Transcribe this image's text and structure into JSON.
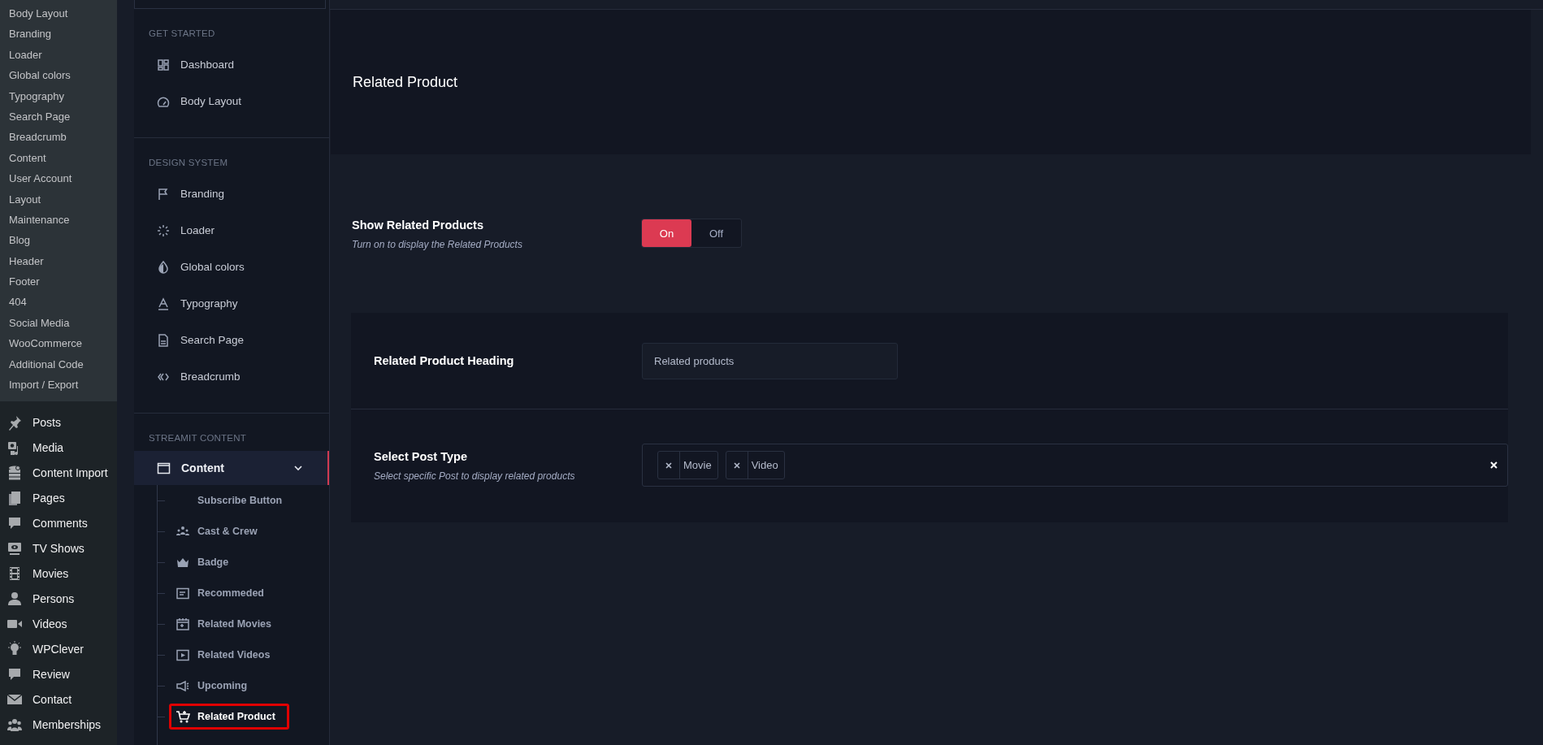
{
  "wp_submenu": [
    "Body Layout",
    "Branding",
    "Loader",
    "Global colors",
    "Typography",
    "Search Page",
    "Breadcrumb",
    "Content",
    "User Account",
    "Layout",
    "Maintenance",
    "Blog",
    "Header",
    "Footer",
    "404",
    "Social Media",
    "WooCommerce",
    "Additional Code",
    "Import / Export"
  ],
  "wp_menu": [
    "Posts",
    "Media",
    "Content Import",
    "Pages",
    "Comments",
    "TV Shows",
    "Movies",
    "Persons",
    "Videos",
    "WPClever",
    "Review",
    "Contact",
    "Memberships"
  ],
  "theme_sidebar": {
    "sections": [
      {
        "title": "GET STARTED",
        "items": [
          {
            "label": "Dashboard",
            "selected": false
          },
          {
            "label": "Body Layout",
            "selected": false
          }
        ]
      },
      {
        "title": "DESIGN SYSTEM",
        "items": [
          {
            "label": "Branding",
            "selected": false
          },
          {
            "label": "Loader",
            "selected": false
          },
          {
            "label": "Global colors",
            "selected": false
          },
          {
            "label": "Typography",
            "selected": false
          },
          {
            "label": "Search Page",
            "selected": false
          },
          {
            "label": "Breadcrumb",
            "selected": false
          }
        ]
      },
      {
        "title": "STREAMIT CONTENT",
        "items": [
          {
            "label": "Content",
            "selected": true,
            "expanded": true,
            "children": [
              {
                "label": "Subscribe Button",
                "selected": false
              },
              {
                "label": "Cast & Crew",
                "selected": false
              },
              {
                "label": "Badge",
                "selected": false
              },
              {
                "label": "Recommeded",
                "selected": false
              },
              {
                "label": "Related Movies",
                "selected": false
              },
              {
                "label": "Related Videos",
                "selected": false
              },
              {
                "label": "Upcoming",
                "selected": false
              },
              {
                "label": "Related Product",
                "selected": true
              }
            ]
          }
        ]
      }
    ]
  },
  "page_title": "Related Product",
  "show_related_products": {
    "label": "Show Related Products",
    "description": "Turn on to display the Related Products",
    "options": [
      {
        "label": "On",
        "selected": true
      },
      {
        "label": "Off",
        "selected": false
      }
    ]
  },
  "heading_field": {
    "label": "Related Product Heading",
    "value": "Related products"
  },
  "post_type": {
    "label": "Select Post Type",
    "description": "Select specific Post to display related products",
    "chips": [
      "Movie",
      "Video"
    ]
  }
}
